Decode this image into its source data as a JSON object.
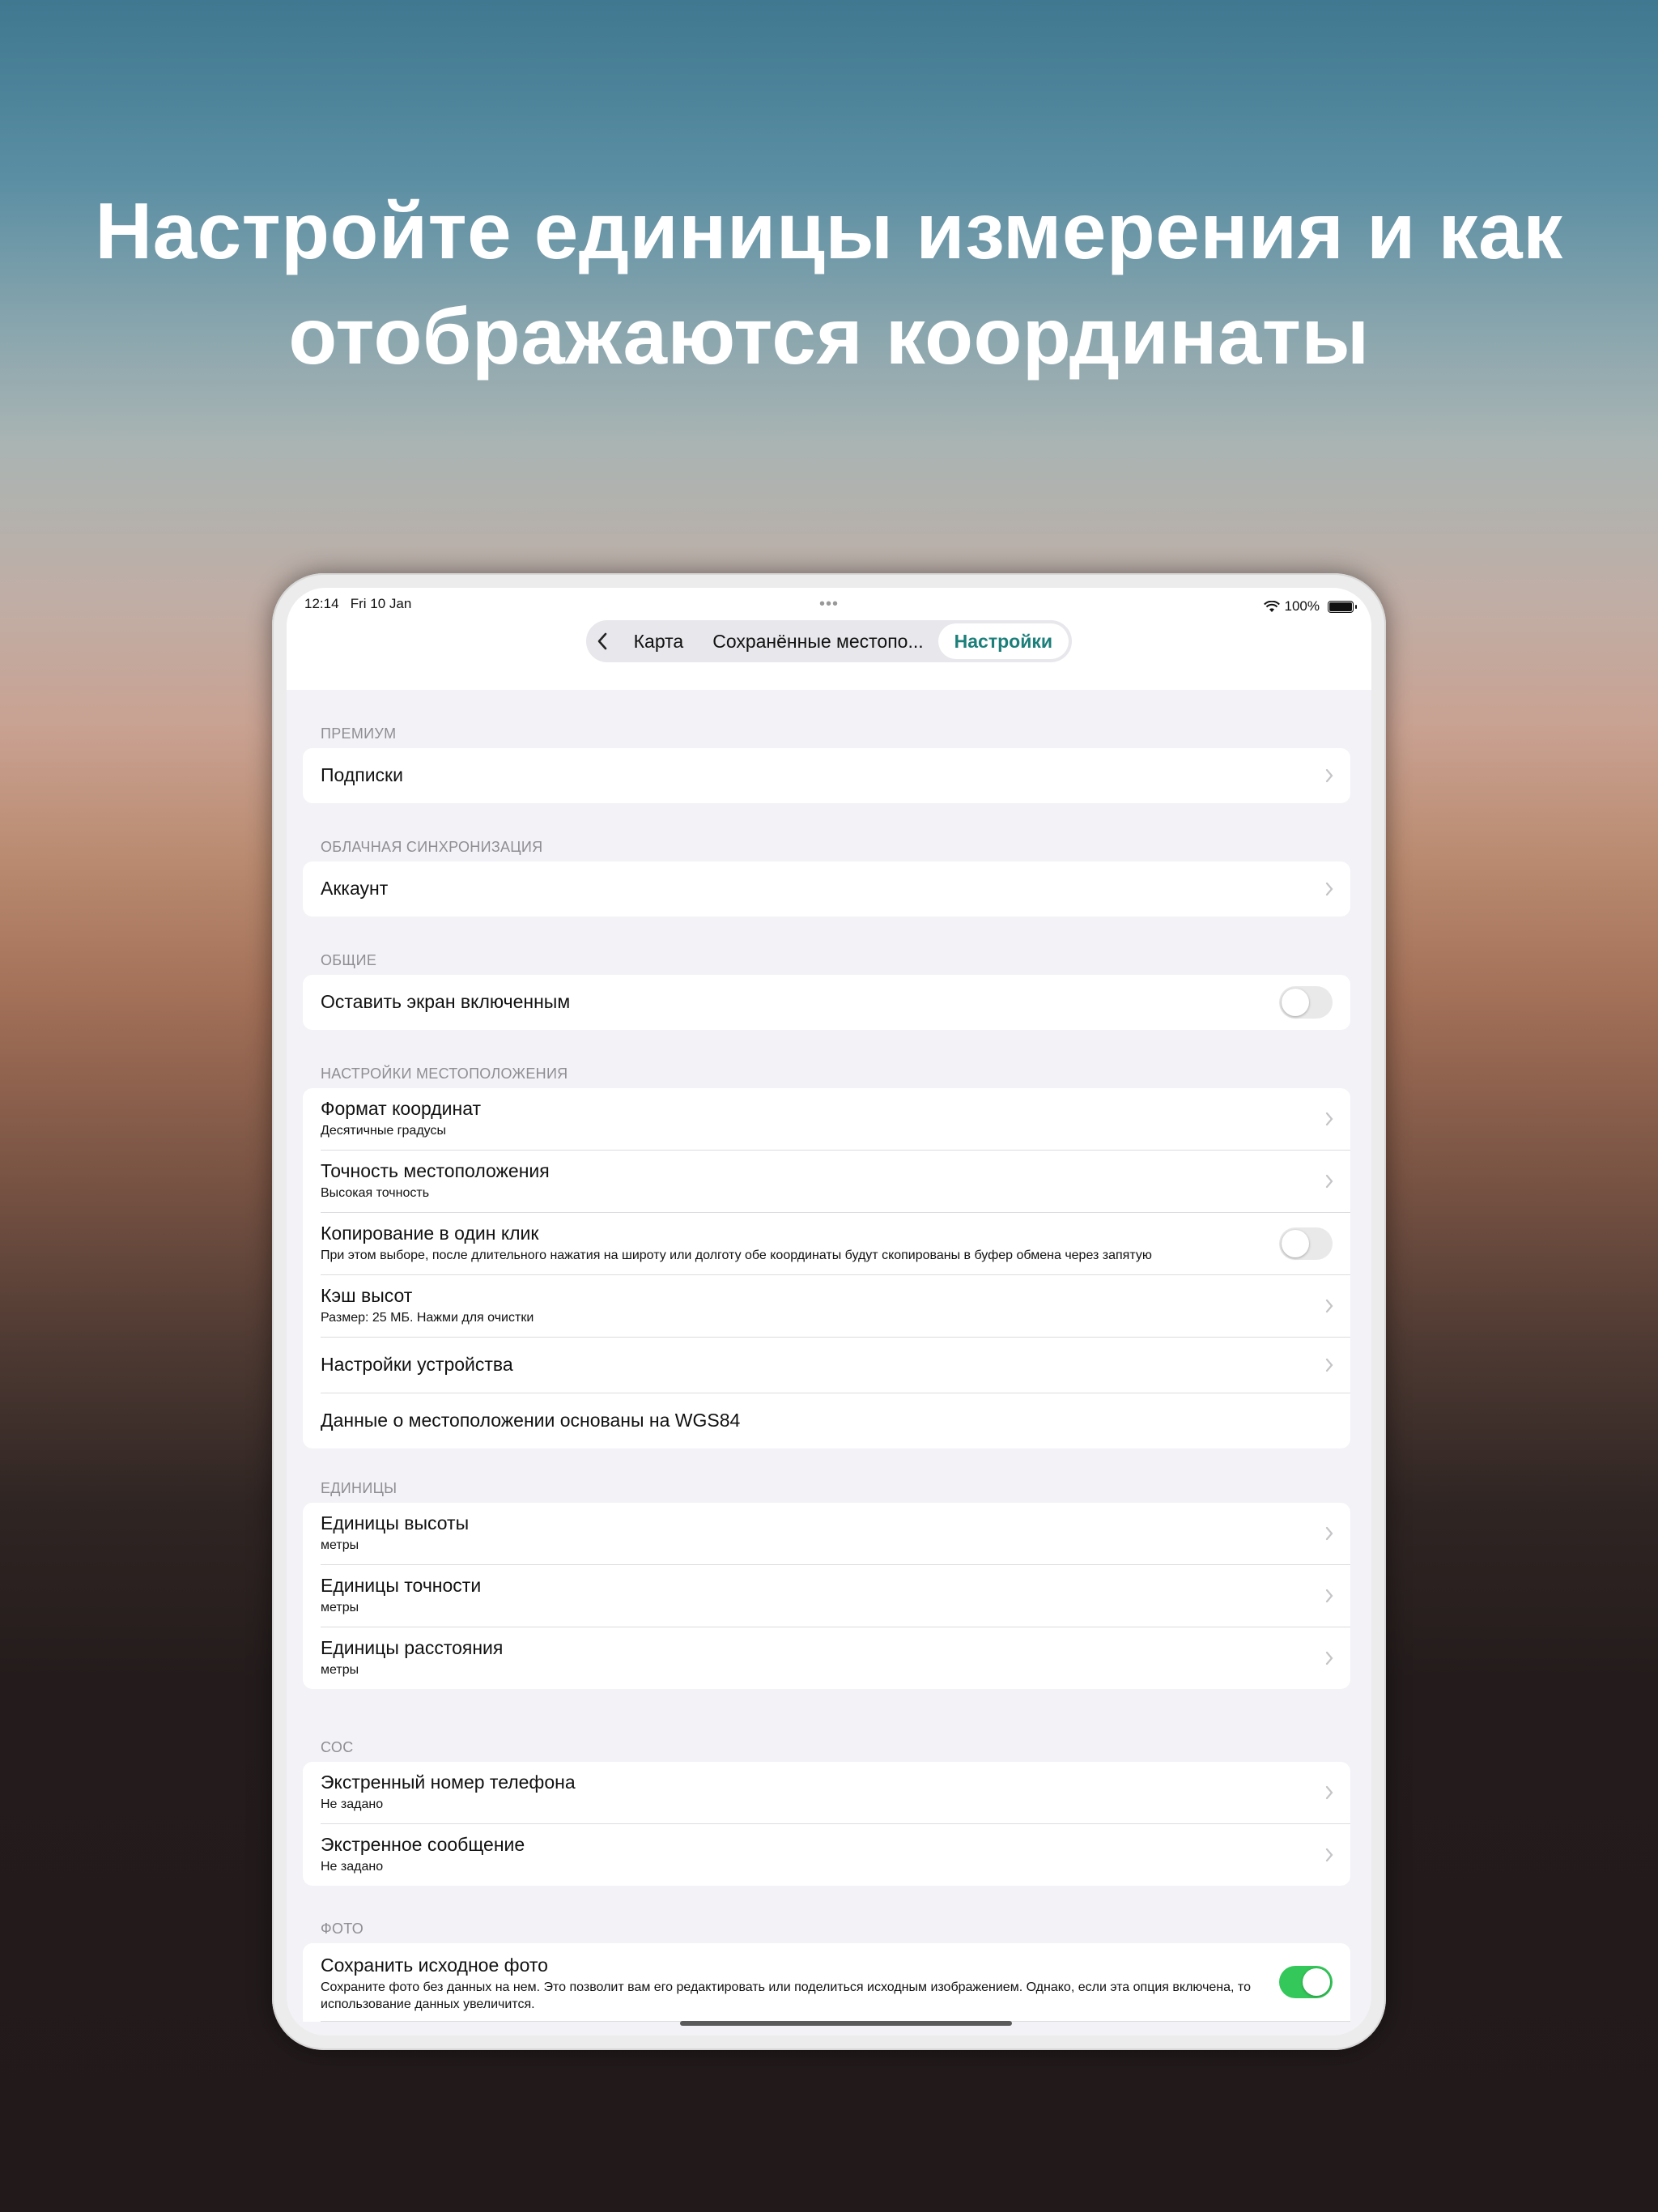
{
  "headline": {
    "line1": "Настройте единицы измерения и как",
    "line2": "отображаются координаты"
  },
  "status_bar": {
    "time": "12:14",
    "date": "Fri 10 Jan",
    "battery": "100%"
  },
  "nav": {
    "tabs": [
      "Карта",
      "Сохранённые местопо...",
      "Настройки"
    ],
    "active_tab": "Настройки",
    "accent_color": "#1c7f7a"
  },
  "sections": {
    "premium": {
      "title": "ПРЕМИУМ",
      "rows": [
        {
          "title": "Подписки"
        }
      ]
    },
    "cloud": {
      "title": "ОБЛАЧНАЯ СИНХРОНИЗАЦИЯ",
      "rows": [
        {
          "title": "Аккаунт"
        }
      ]
    },
    "general": {
      "title": "ОБЩИЕ",
      "rows": [
        {
          "title": "Оставить экран включенным",
          "toggle": false
        }
      ]
    },
    "location": {
      "title": "НАСТРОЙКИ МЕСТОПОЛОЖЕНИЯ",
      "rows": [
        {
          "title": "Формат координат",
          "subtitle": "Десятичные градусы"
        },
        {
          "title": "Точность местоположения",
          "subtitle": "Высокая точность"
        },
        {
          "title": "Копирование в один клик",
          "subtitle": "При этом выборе, после длительного нажатия на широту или долготу обе координаты будут скопированы в буфер обмена через запятую",
          "toggle": false
        },
        {
          "title": "Кэш высот",
          "subtitle": "Размер: 25 МБ. Нажми для очистки"
        },
        {
          "title": "Настройки устройства"
        },
        {
          "title": "Данные о местоположении основаны на WGS84"
        }
      ]
    },
    "units": {
      "title": "ЕДИНИЦЫ",
      "rows": [
        {
          "title": "Единицы высоты",
          "subtitle": "метры"
        },
        {
          "title": "Единицы точности",
          "subtitle": "метры"
        },
        {
          "title": "Единицы расстояния",
          "subtitle": "метры"
        }
      ]
    },
    "sos": {
      "title": "СОС",
      "rows": [
        {
          "title": "Экстренный номер телефона",
          "subtitle": "Не задано"
        },
        {
          "title": "Экстренное сообщение",
          "subtitle": "Не задано"
        }
      ]
    },
    "photo": {
      "title": "ФОТО",
      "rows": [
        {
          "title": "Сохранить исходное фото",
          "subtitle": "Сохраните фото без данных на нем. Это позволит вам его редактировать или поделиться исходным изображением. Однако, если эта опция включена, то использование данных увеличится.",
          "toggle": true
        }
      ]
    }
  },
  "colors": {
    "toggle_on": "#34c759",
    "toggle_off": "#e9e9ea"
  }
}
